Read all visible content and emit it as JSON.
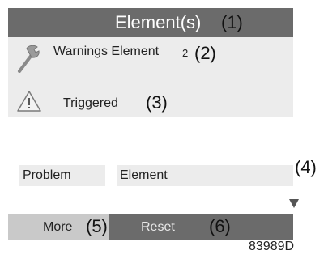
{
  "title_bar": {
    "title": "Element(s)",
    "callout": "(1)"
  },
  "rows": {
    "warnings": {
      "icon": "wrench-icon",
      "label": "Warnings Element",
      "suffix": "2",
      "callout": "(2)"
    },
    "status": {
      "icon": "warning-triangle-icon",
      "label": "Triggered",
      "callout": "(3)"
    }
  },
  "detail": {
    "problem_label": "Problem",
    "problem_value": "Element",
    "callout": "(4)",
    "scroll_icon": "scroll-down-arrow-icon"
  },
  "buttons": {
    "more_label": "More",
    "more_callout": "(5)",
    "reset_label": "Reset",
    "reset_callout": "(6)"
  },
  "figure_code": "83989D",
  "colors": {
    "title_bar": "#6b6b6b",
    "row_background": "#ececec",
    "more_button": "#c9c9c9",
    "reset_button": "#6b6b6b"
  }
}
